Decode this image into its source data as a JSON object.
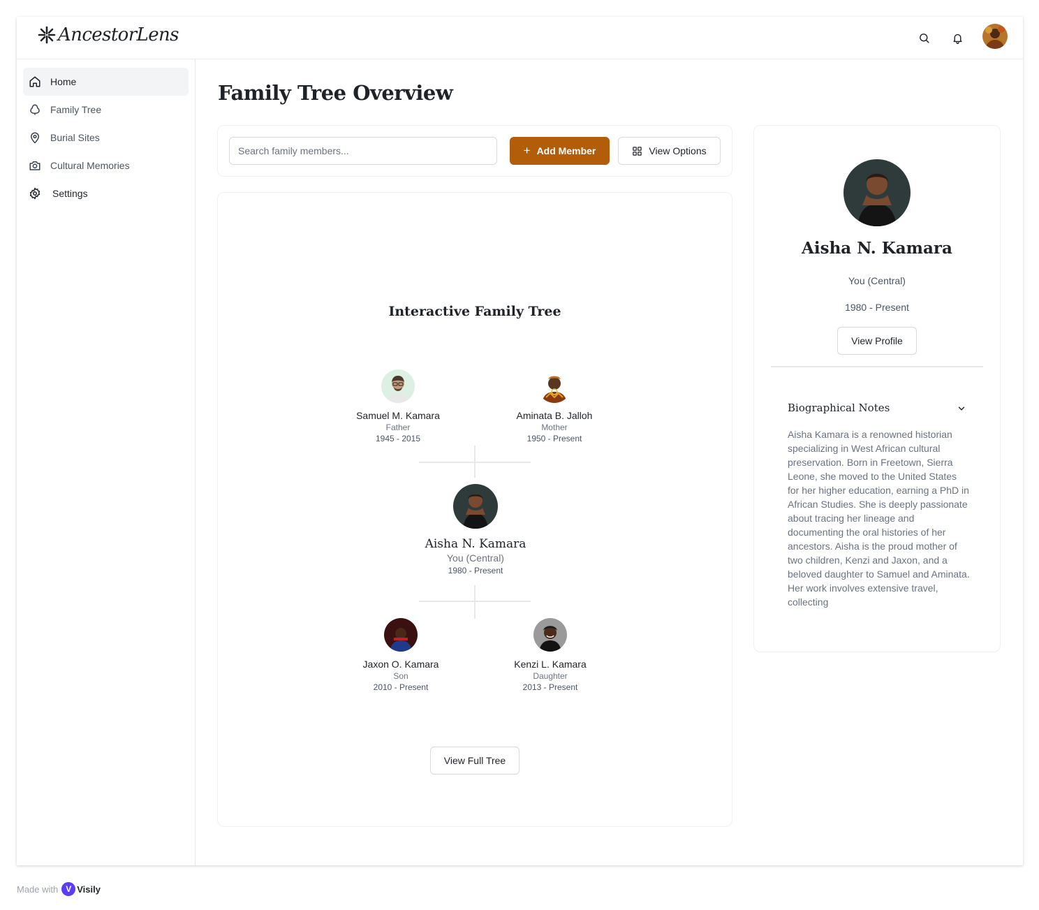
{
  "app": {
    "name": "AncestorLens"
  },
  "header": {
    "icons": [
      "search-icon",
      "bell-icon"
    ],
    "avatar": "user-avatar"
  },
  "sidebar": {
    "items": [
      {
        "label": "Home",
        "icon": "home-icon",
        "active": true
      },
      {
        "label": "Family Tree",
        "icon": "tree-icon",
        "active": false
      },
      {
        "label": "Burial Sites",
        "icon": "map-pin-icon",
        "active": false
      },
      {
        "label": "Cultural Memories",
        "icon": "camera-icon",
        "active": false
      },
      {
        "label": "Settings",
        "icon": "gear-icon",
        "active": false
      }
    ]
  },
  "main": {
    "title": "Family Tree Overview",
    "search": {
      "placeholder": "Search family members...",
      "value": ""
    },
    "add_member_label": "Add Member",
    "view_options_label": "View Options"
  },
  "tree": {
    "title": "Interactive Family Tree",
    "parents": [
      {
        "name": "Samuel M. Kamara",
        "role": "Father",
        "years": "1945 - 2015"
      },
      {
        "name": "Aminata B. Jalloh",
        "role": "Mother",
        "years": "1950 - Present"
      }
    ],
    "central": {
      "name": "Aisha N. Kamara",
      "role": "You (Central)",
      "years": "1980 - Present"
    },
    "children": [
      {
        "name": "Jaxon O. Kamara",
        "role": "Son",
        "years": "2010 - Present"
      },
      {
        "name": "Kenzi L. Kamara",
        "role": "Daughter",
        "years": "2013 - Present"
      }
    ],
    "view_full_label": "View Full Tree"
  },
  "profile": {
    "name": "Aisha N. Kamara",
    "role": "You (Central)",
    "years": "1980 - Present",
    "view_profile_label": "View Profile",
    "bio_title": "Biographical Notes",
    "bio_text": "Aisha Kamara is a renowned historian specializing in West African cultural preservation. Born in Freetown, Sierra Leone, she moved to the United States for her higher education, earning a PhD in African Studies. She is deeply passionate about tracing her lineage and documenting the oral histories of her ancestors. Aisha is the proud mother of two children, Kenzi and Jaxon, and a beloved daughter to Samuel and Aminata. Her work involves extensive travel, collecting"
  },
  "footer": {
    "made_with": "Made with",
    "brand": "Visily"
  },
  "colors": {
    "accent": "#b15d0a",
    "border": "#d8dadd",
    "muted": "#6b7280"
  }
}
